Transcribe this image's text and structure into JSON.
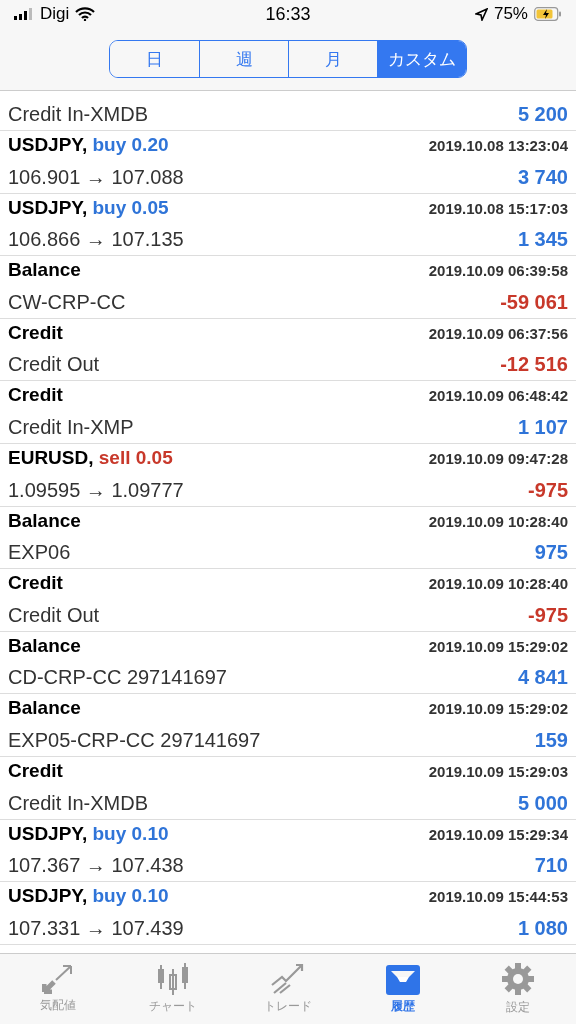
{
  "status_bar": {
    "carrier": "Digi",
    "time": "16:33",
    "battery": "75%"
  },
  "period_tabs": [
    {
      "label": "日",
      "selected": false
    },
    {
      "label": "週",
      "selected": false
    },
    {
      "label": "月",
      "selected": false
    },
    {
      "label": "カスタム",
      "selected": true
    }
  ],
  "rows": [
    {
      "kind": "partial",
      "details": "Credit In-XMDB",
      "amount": "5 200",
      "loss": false
    },
    {
      "kind": "buy",
      "symbol": "USDJPY,",
      "side": "buy 0.20",
      "time": "2019.10.08 13:23:04",
      "details": "106.901 → 107.088",
      "amount": "3 740",
      "loss": false
    },
    {
      "kind": "buy",
      "symbol": "USDJPY,",
      "side": "buy 0.05",
      "time": "2019.10.08 15:17:03",
      "details": "106.866 → 107.135",
      "amount": "1 345",
      "loss": false
    },
    {
      "kind": "operation",
      "symbol": "Balance",
      "time": "2019.10.09 06:39:58",
      "details": "CW-CRP-CC",
      "amount": "-59 061",
      "loss": true
    },
    {
      "kind": "operation",
      "symbol": "Credit",
      "time": "2019.10.09 06:37:56",
      "details": "Credit Out",
      "amount": "-12 516",
      "loss": true
    },
    {
      "kind": "operation",
      "symbol": "Credit",
      "time": "2019.10.09 06:48:42",
      "details": "Credit In-XMP",
      "amount": "1 107",
      "loss": false
    },
    {
      "kind": "sell",
      "symbol": "EURUSD,",
      "side": "sell 0.05",
      "time": "2019.10.09 09:47:28",
      "details": "1.09595 → 1.09777",
      "amount": "-975",
      "loss": true
    },
    {
      "kind": "operation",
      "symbol": "Balance",
      "time": "2019.10.09 10:28:40",
      "details": "EXP06",
      "amount": "975",
      "loss": false
    },
    {
      "kind": "operation",
      "symbol": "Credit",
      "time": "2019.10.09 10:28:40",
      "details": "Credit Out",
      "amount": "-975",
      "loss": true
    },
    {
      "kind": "operation",
      "symbol": "Balance",
      "time": "2019.10.09 15:29:02",
      "details": "CD-CRP-CC 297141697",
      "amount": "4 841",
      "loss": false
    },
    {
      "kind": "operation",
      "symbol": "Balance",
      "time": "2019.10.09 15:29:02",
      "details": "EXP05-CRP-CC 297141697",
      "amount": "159",
      "loss": false
    },
    {
      "kind": "operation",
      "symbol": "Credit",
      "time": "2019.10.09 15:29:03",
      "details": "Credit In-XMDB",
      "amount": "5 000",
      "loss": false
    },
    {
      "kind": "buy",
      "symbol": "USDJPY,",
      "side": "buy 0.10",
      "time": "2019.10.09 15:29:34",
      "details": "107.367 → 107.438",
      "amount": "710",
      "loss": false
    },
    {
      "kind": "buy",
      "symbol": "USDJPY,",
      "side": "buy 0.10",
      "time": "2019.10.09 15:44:53",
      "details": "107.331 → 107.439",
      "amount": "1 080",
      "loss": false
    }
  ],
  "tab_bar": [
    {
      "label": "気配値",
      "kind": "quotes",
      "selected": false
    },
    {
      "label": "チャート",
      "kind": "chart",
      "selected": false
    },
    {
      "label": "トレード",
      "kind": "trade",
      "selected": false
    },
    {
      "label": "履歴",
      "kind": "history",
      "selected": true
    },
    {
      "label": "設定",
      "kind": "settings",
      "selected": false
    }
  ]
}
